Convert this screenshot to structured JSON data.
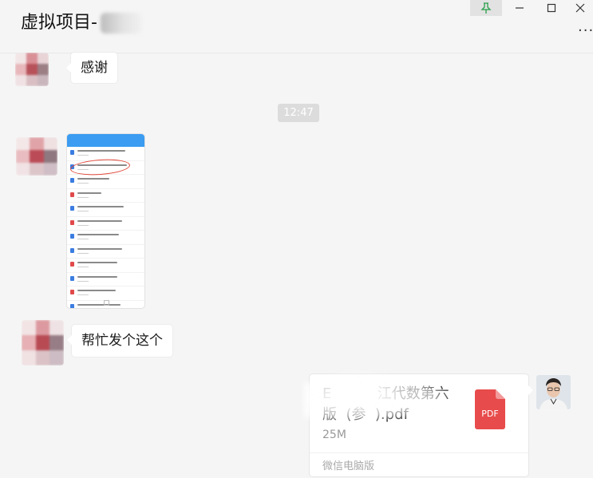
{
  "header": {
    "title": "虚拟项目-",
    "pin_icon": "pin-icon",
    "minimize_icon": "minimize-icon",
    "maximize_icon": "maximize-icon",
    "close_icon": "close-icon",
    "more_label": "..."
  },
  "messages": {
    "m1": {
      "text": "感谢"
    },
    "time": "12:47",
    "m3": {
      "text": "帮忙发个这个"
    },
    "file": {
      "name": "E          江代数第六版  (参  ).pdf",
      "size": "25M",
      "type_label": "PDF",
      "source": "微信电脑版"
    }
  },
  "colors": {
    "background": "#f5f5f5",
    "bubble": "#ffffff",
    "pdf_red": "#e84b4b",
    "phone_bar": "#3b9cf1"
  }
}
